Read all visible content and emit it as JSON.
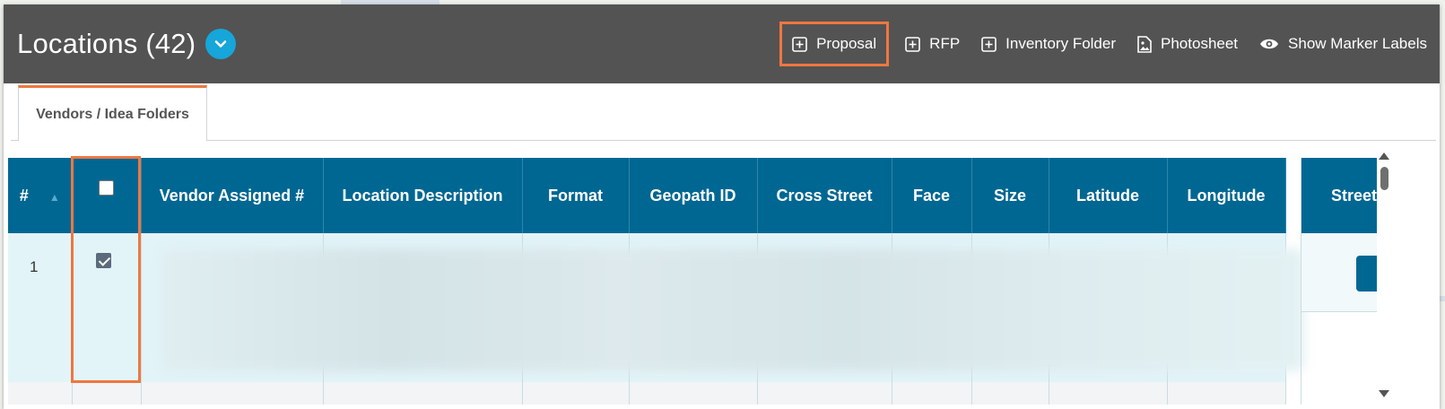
{
  "header": {
    "title": "Locations (42)",
    "actions": [
      {
        "label": "Proposal",
        "icon": "plus-square-icon"
      },
      {
        "label": "RFP",
        "icon": "plus-square-icon"
      },
      {
        "label": "Inventory Folder",
        "icon": "plus-square-icon"
      },
      {
        "label": "Photosheet",
        "icon": "image-file-icon"
      },
      {
        "label": "Show Marker Labels",
        "icon": "eye-icon"
      }
    ]
  },
  "tabs": {
    "active": "Vendors / Idea Folders"
  },
  "table": {
    "columns": [
      "#",
      "",
      "Vendor Assigned #",
      "Location Description",
      "Format",
      "Geopath ID",
      "Cross Street",
      "Face",
      "Size",
      "Latitude",
      "Longitude"
    ],
    "sticky_column": "Street",
    "rows": [
      {
        "num": "1",
        "checked": true
      }
    ]
  },
  "colors": {
    "accent": "#ee7740",
    "header_bg": "#535353",
    "table_header": "#006792",
    "dropdown": "#16a6d9"
  }
}
